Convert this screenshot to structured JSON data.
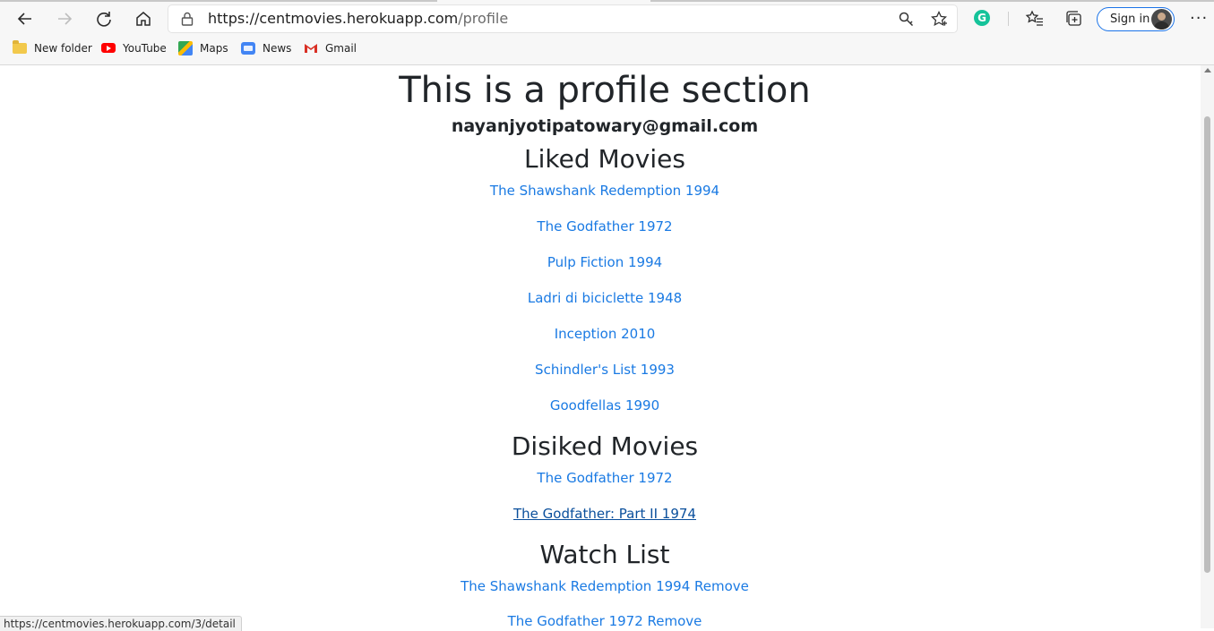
{
  "browser": {
    "url_host": "https://centmovies.herokuapp.com",
    "url_path": "/profile",
    "sign_in_label": "Sign in",
    "more_label": "···",
    "extension_letter": "G",
    "bookmarks": [
      {
        "label": "New folder",
        "icon": "folder-icon"
      },
      {
        "label": "YouTube",
        "icon": "youtube-icon"
      },
      {
        "label": "Maps",
        "icon": "maps-icon"
      },
      {
        "label": "News",
        "icon": "news-icon"
      },
      {
        "label": "Gmail",
        "icon": "gmail-icon"
      }
    ],
    "status_url": "https://centmovies.herokuapp.com/3/detail"
  },
  "page": {
    "title": "This is a profile section",
    "email": "nayanjyotipatowary@gmail.com",
    "liked_heading": "Liked Movies",
    "liked": [
      "The Shawshank Redemption 1994",
      "The Godfather 1972",
      "Pulp Fiction 1994",
      "Ladri di biciclette 1948",
      "Inception 2010",
      "Schindler's List 1993",
      "Goodfellas 1990"
    ],
    "disliked_heading": "Disiked Movies",
    "disliked": [
      "The Godfather 1972",
      "The Godfather: Part II 1974"
    ],
    "watch_heading": "Watch List",
    "watch": [
      "The Shawshank Redemption 1994 Remove",
      "The Godfather 1972 Remove"
    ]
  },
  "colors": {
    "link": "#1a7ae3",
    "link_hover": "#0a4f9c",
    "heading": "#212529",
    "signin_border": "#1a73e8",
    "grammarly": "#15c39a"
  }
}
